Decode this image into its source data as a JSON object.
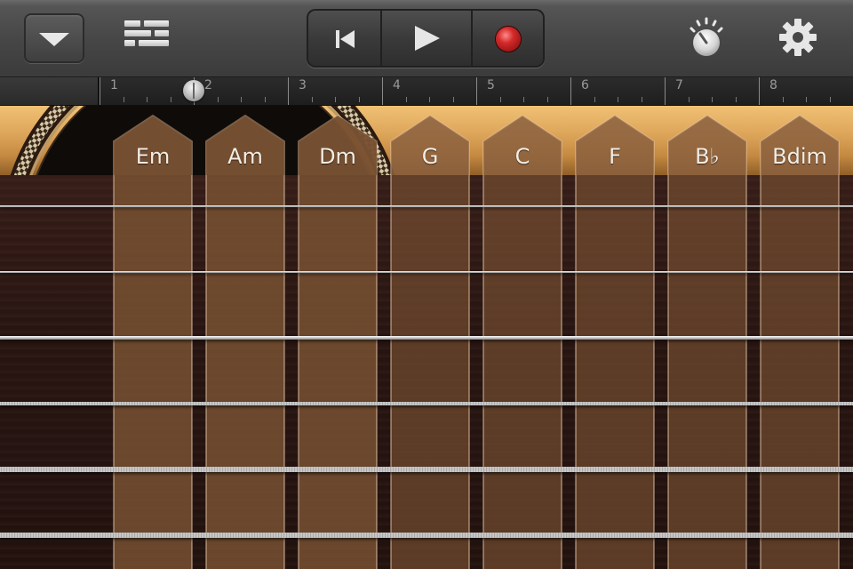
{
  "toolbar": {
    "menu_button_icon": "triangle-down-icon",
    "tracks_view_icon": "tracks-view-icon",
    "transport": {
      "rewind_icon": "go-to-beginning-icon",
      "play_icon": "play-icon",
      "record_icon": "record-icon"
    },
    "metronome_icon": "metronome-icon",
    "settings_icon": "gear-icon"
  },
  "ruler": {
    "bars": [
      "1",
      "2",
      "3",
      "4",
      "5",
      "6",
      "7",
      "8"
    ],
    "playhead_bar": "1.95"
  },
  "chords": [
    {
      "label": "Em",
      "pressed": true
    },
    {
      "label": "Am",
      "pressed": true
    },
    {
      "label": "Dm",
      "pressed": true
    },
    {
      "label": "G",
      "pressed": false
    },
    {
      "label": "C",
      "pressed": false
    },
    {
      "label": "F",
      "pressed": false
    },
    {
      "label": "B♭",
      "pressed": false
    },
    {
      "label": "Bdim",
      "pressed": false
    }
  ],
  "strings": 6,
  "colors": {
    "record": "#d42a2a",
    "wood_top": "#f0c174",
    "fretboard": "#2a1612",
    "chord_strip": "#7a4f30"
  }
}
